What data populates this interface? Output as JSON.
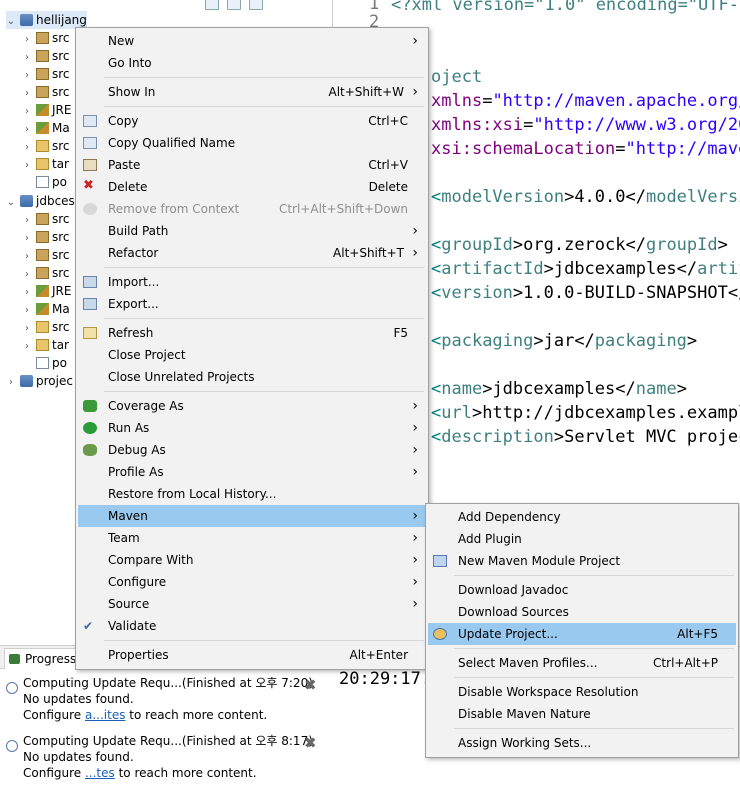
{
  "explorer": {
    "rows": [
      {
        "label": "hellijang",
        "type": "proj",
        "depth": 0,
        "expanded": true,
        "selected": true
      },
      {
        "label": "src",
        "type": "pkg",
        "depth": 1
      },
      {
        "label": "src",
        "type": "pkg",
        "depth": 1
      },
      {
        "label": "src",
        "type": "pkg",
        "depth": 1
      },
      {
        "label": "src",
        "type": "pkg",
        "depth": 1
      },
      {
        "label": "JRE",
        "type": "lib",
        "depth": 1
      },
      {
        "label": "Ma",
        "type": "lib",
        "depth": 1
      },
      {
        "label": "src",
        "type": "fold",
        "depth": 1
      },
      {
        "label": "tar",
        "type": "fold",
        "depth": 1
      },
      {
        "label": "po",
        "type": "file",
        "depth": 1,
        "noArrow": true
      },
      {
        "label": "jdbces",
        "type": "proj",
        "depth": 0,
        "expanded": true
      },
      {
        "label": "src",
        "type": "pkg",
        "depth": 1
      },
      {
        "label": "src",
        "type": "pkg",
        "depth": 1
      },
      {
        "label": "src",
        "type": "pkg",
        "depth": 1
      },
      {
        "label": "src",
        "type": "pkg",
        "depth": 1
      },
      {
        "label": "JRE",
        "type": "lib",
        "depth": 1
      },
      {
        "label": "Ma",
        "type": "lib",
        "depth": 1
      },
      {
        "label": "src",
        "type": "fold",
        "depth": 1
      },
      {
        "label": "tar",
        "type": "fold",
        "depth": 1
      },
      {
        "label": "po",
        "type": "file",
        "depth": 1,
        "noArrow": true
      },
      {
        "label": "projec",
        "type": "proj",
        "depth": 0
      }
    ]
  },
  "editor": {
    "line_numbers": [
      "1",
      "2"
    ],
    "lines": [
      [
        {
          "t": "<?xml version=\"1.0\" encoding=\"UTF-8",
          "c": "tag"
        }
      ],
      [],
      [],
      [
        {
          "t": "oject",
          "c": "tag"
        }
      ],
      [
        {
          "t": "xmlns",
          "c": "attr"
        },
        {
          "t": "=",
          "c": ""
        },
        {
          "t": "\"http://maven.apache.org/",
          "c": "str"
        }
      ],
      [
        {
          "t": "xmlns:xsi",
          "c": "attr"
        },
        {
          "t": "=",
          "c": ""
        },
        {
          "t": "\"http://www.w3.org/20",
          "c": "str"
        }
      ],
      [
        {
          "t": "xsi:schemaLocation",
          "c": "attr"
        },
        {
          "t": "=",
          "c": ""
        },
        {
          "t": "\"http://mave",
          "c": "str"
        }
      ],
      [],
      [
        {
          "t": "<",
          "c": "brk"
        },
        {
          "t": "modelVersion",
          "c": "tag"
        },
        {
          "t": ">4.0.0</",
          "c": ""
        },
        {
          "t": "modelVersi",
          "c": "tag"
        }
      ],
      [],
      [
        {
          "t": "<",
          "c": "brk"
        },
        {
          "t": "groupId",
          "c": "tag"
        },
        {
          "t": ">org.zerock</",
          "c": ""
        },
        {
          "t": "groupId",
          "c": "tag"
        },
        {
          "t": ">",
          "c": ""
        }
      ],
      [
        {
          "t": "<",
          "c": "brk"
        },
        {
          "t": "artifactId",
          "c": "tag"
        },
        {
          "t": ">jdbcexamples</",
          "c": ""
        },
        {
          "t": "artif",
          "c": "tag"
        }
      ],
      [
        {
          "t": "<",
          "c": "brk"
        },
        {
          "t": "version",
          "c": "tag"
        },
        {
          "t": ">1.0.0-BUILD-SNAPSHOT</",
          "c": ""
        }
      ],
      [],
      [
        {
          "t": "<",
          "c": "brk"
        },
        {
          "t": "packaging",
          "c": "tag"
        },
        {
          "t": ">jar</",
          "c": ""
        },
        {
          "t": "packaging",
          "c": "tag"
        },
        {
          "t": ">",
          "c": ""
        }
      ],
      [],
      [
        {
          "t": "<",
          "c": "brk"
        },
        {
          "t": "name",
          "c": "tag"
        },
        {
          "t": ">jdbcexamples</",
          "c": ""
        },
        {
          "t": "name",
          "c": "tag"
        },
        {
          "t": ">",
          "c": ""
        }
      ],
      [
        {
          "t": "<",
          "c": "brk"
        },
        {
          "t": "url",
          "c": "tag"
        },
        {
          "t": ">http://jdbcexamples.exampl",
          "c": ""
        }
      ],
      [
        {
          "t": "<",
          "c": "brk"
        },
        {
          "t": "description",
          "c": "tag"
        },
        {
          "t": ">Servlet MVC projec",
          "c": ""
        }
      ]
    ]
  },
  "progress": {
    "tab_label": "Progress",
    "entries": [
      {
        "title": "Computing Update Requ...(Finished at 오후 7:20)",
        "status": "No updates found.",
        "pre": "Configure ",
        "link": "a...ites",
        "post": " to reach more content."
      },
      {
        "title": "Computing Update Requ...(Finished at 오후 8:17)",
        "status": "No updates found.",
        "pre": "Configure ",
        "link": "...tes",
        "post": " to reach more content."
      }
    ]
  },
  "console": {
    "timestamp": "20:29:17."
  },
  "context_menu": [
    {
      "label": "New",
      "arrow": true
    },
    {
      "label": "Go Into"
    },
    {
      "sep": true
    },
    {
      "label": "Show In",
      "shortcut": "Alt+Shift+W",
      "arrow": true
    },
    {
      "sep": true
    },
    {
      "label": "Copy",
      "shortcut": "Ctrl+C",
      "icon": "copy-icon"
    },
    {
      "label": "Copy Qualified Name",
      "icon": "copy-qualified-icon"
    },
    {
      "label": "Paste",
      "shortcut": "Ctrl+V",
      "icon": "paste-icon"
    },
    {
      "label": "Delete",
      "shortcut": "Delete",
      "icon": "delete-icon"
    },
    {
      "label": "Remove from Context",
      "shortcut": "Ctrl+Alt+Shift+Down",
      "icon": "remove-context-icon",
      "disabled": true
    },
    {
      "label": "Build Path",
      "arrow": true
    },
    {
      "label": "Refactor",
      "shortcut": "Alt+Shift+T",
      "arrow": true
    },
    {
      "sep": true
    },
    {
      "label": "Import...",
      "icon": "import-icon"
    },
    {
      "label": "Export...",
      "icon": "export-icon"
    },
    {
      "sep": true
    },
    {
      "label": "Refresh",
      "shortcut": "F5",
      "icon": "refresh-icon"
    },
    {
      "label": "Close Project"
    },
    {
      "label": "Close Unrelated Projects"
    },
    {
      "sep": true
    },
    {
      "label": "Coverage As",
      "arrow": true,
      "icon": "coverage-icon"
    },
    {
      "label": "Run As",
      "arrow": true,
      "icon": "run-icon"
    },
    {
      "label": "Debug As",
      "arrow": true,
      "icon": "debug-icon"
    },
    {
      "label": "Profile As",
      "arrow": true
    },
    {
      "label": "Restore from Local History..."
    },
    {
      "label": "Maven",
      "arrow": true,
      "highlight": true
    },
    {
      "label": "Team",
      "arrow": true
    },
    {
      "label": "Compare With",
      "arrow": true
    },
    {
      "label": "Configure",
      "arrow": true
    },
    {
      "label": "Source",
      "arrow": true
    },
    {
      "label": "Validate",
      "icon": "check-icon"
    },
    {
      "sep": true
    },
    {
      "label": "Properties",
      "shortcut": "Alt+Enter"
    }
  ],
  "maven_menu": [
    {
      "label": "Add Dependency"
    },
    {
      "label": "Add Plugin"
    },
    {
      "label": "New Maven Module Project",
      "icon": "maven-module-icon"
    },
    {
      "sep": true
    },
    {
      "label": "Download Javadoc"
    },
    {
      "label": "Download Sources"
    },
    {
      "label": "Update Project...",
      "shortcut": "Alt+F5",
      "icon": "update-project-icon",
      "highlight": true
    },
    {
      "sep": true
    },
    {
      "label": "Select Maven Profiles...",
      "shortcut": "Ctrl+Alt+P"
    },
    {
      "sep": true
    },
    {
      "label": "Disable Workspace Resolution"
    },
    {
      "label": "Disable Maven Nature"
    },
    {
      "sep": true
    },
    {
      "label": "Assign Working Sets..."
    }
  ]
}
